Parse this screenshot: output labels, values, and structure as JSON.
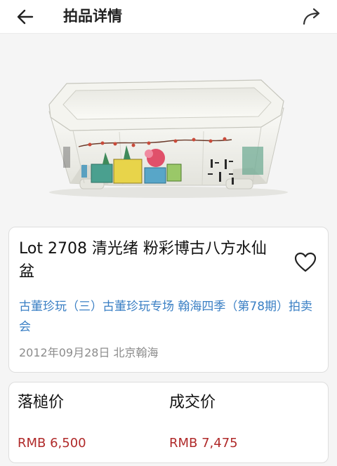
{
  "header": {
    "title": "拍品详情",
    "back_icon": "arrow-left-icon",
    "share_icon": "share-arrow-icon"
  },
  "item": {
    "title": "Lot 2708 清光绪 粉彩博古八方水仙盆",
    "sale": "古董珍玩（三）古董珍玩专场 翰海四季（第78期）拍卖会",
    "meta": "2012年09月28日 北京翰海",
    "favorite_icon": "heart-outline-icon"
  },
  "prices": {
    "hammer_label": "落槌价",
    "hammer_value": "RMB 6,500",
    "final_label": "成交价",
    "final_value": "RMB 7,475"
  },
  "colors": {
    "link": "#3a7fc4",
    "price": "#b02a2a",
    "meta": "#8c8c8c"
  }
}
